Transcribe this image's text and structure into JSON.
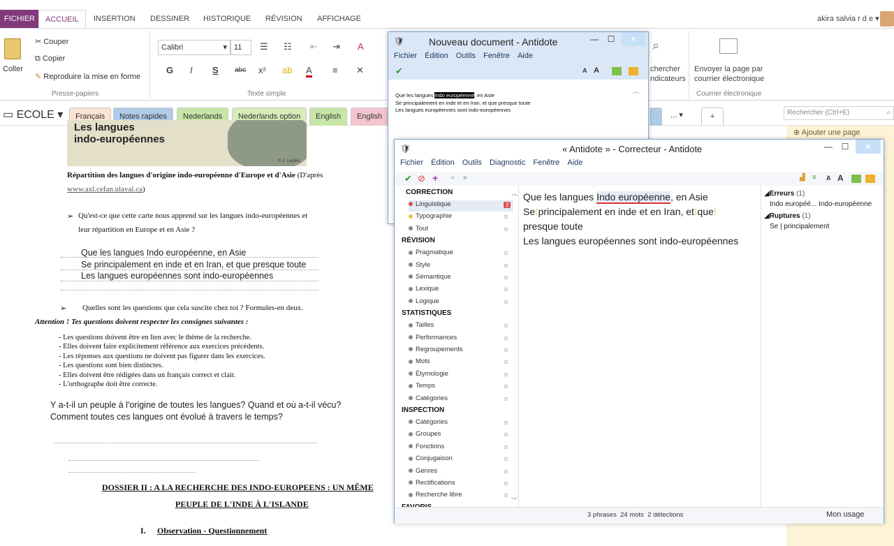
{
  "ribbon": {
    "tabs": [
      "FICHIER",
      "ACCUEIL",
      "INSERTION",
      "DESSINER",
      "HISTORIQUE",
      "RÉVISION",
      "AFFICHAGE"
    ],
    "active_tab": "ACCUEIL",
    "user": "akira salvia r d e",
    "clipboard": {
      "paste": "Coller",
      "cut": "Couper",
      "copy": "Copier",
      "format_painter": "Reproduire la mise en forme",
      "group": "Presse-papiers"
    },
    "font": {
      "name": "Calibri",
      "size": "11",
      "group": "Texte simple"
    },
    "search_tags": {
      "line1": "chercher",
      "line2": "ndicateurs"
    },
    "email": {
      "line1": "Envoyer la page par",
      "line2": "courrier électronique",
      "group": "Courrier électronique"
    }
  },
  "notebook": {
    "name": "ECOLE",
    "sections": [
      "Français",
      "Notes rapides",
      "Nederlands",
      "Nederlands option",
      "English",
      "English o"
    ],
    "section_colors": [
      "#fbe3d3",
      "#aecbe8",
      "#c8e6a7",
      "#d6edb9",
      "#c8e6a7",
      "#f4c5d0"
    ],
    "more": "...",
    "add": "+",
    "search_placeholder": "Rechercher (Ctrl+E)",
    "add_page": "Ajouter une page"
  },
  "page": {
    "map_title_1": "Les langues",
    "map_title_2": "indo-européennes",
    "map_credit": "© J. Leclerc",
    "repartition_bold": "Répartition des langues d'origine indo-européenne d'Europe et d'Asie",
    "repartition_rest": " (D'après",
    "link": "www.axl.cefan.ulaval.ca",
    "link_close": ")",
    "q1_line1": "Qu'est-ce que cette carte nous apprend sur les langues indo-européennes et",
    "q1_line2": "leur répartition en Europe et en Asie ?",
    "ans1": [
      "Que les langues Indo européenne, en Asie",
      "Se principalement en inde et en Iran, et que presque toute",
      "Les langues européennes sont indo-européennes"
    ],
    "q2": "Quelles sont les questions que cela suscite chez toi ? Formules-en deux.",
    "attention": "Attention ! Tes questions doivent respecter les consignes suivantes :",
    "rules": [
      "- Les questions doivent être en lien avec le thème de la recherche.",
      "- Elles doivent faire explicitement référence aux exercices précédents.",
      "- Les réponses aux questions ne doivent pas figurer dans les exercices.",
      "- Les questions sont bien distinctes.",
      "- Elles doivent être rédigées dans un français correct et clair.",
      "- L'orthographe doit être correcte."
    ],
    "ans2": [
      "Y a-t-il un peuple à l'origine de toutes les langues? Quand et où a-t-il vécu?",
      "Comment toutes ces langues ont évolué à travers le temps?"
    ],
    "dossier_1": "DOSSIER II : A LA RECHERCHE DES INDO-EUROPEENS : UN MÊME",
    "dossier_2": "PEUPLE DE L'INDE À L'ISLANDE",
    "obs_num": "I.",
    "obs": "Observation - Questionnement"
  },
  "doc_window": {
    "title": "Nouveau document - Antidote",
    "menu": [
      "Fichier",
      "Édition",
      "Outils",
      "Fenêtre",
      "Aide"
    ],
    "lines": [
      "Que les langues ",
      "Indo européenne",
      ", en Asie",
      "Se principalement en inde et en Iran, et que presque toute",
      "Les langues européennes sont indo-européennes"
    ]
  },
  "corrector": {
    "title": "« Antidote » - Correcteur - Antidote",
    "menu": [
      "Fichier",
      "Édition",
      "Outils",
      "Diagnostic",
      "Fenêtre",
      "Aide"
    ],
    "nav": [
      {
        "type": "section",
        "label": "CORRECTION"
      },
      {
        "type": "item",
        "label": "Linguistique",
        "color": "#e05050",
        "badge": "2",
        "selected": true
      },
      {
        "type": "item",
        "label": "Typographie",
        "color": "#e8c04a"
      },
      {
        "type": "item",
        "label": "Tout",
        "color": "#888"
      },
      {
        "type": "section",
        "label": "RÉVISION"
      },
      {
        "type": "item",
        "label": "Pragmatique",
        "color": "#888"
      },
      {
        "type": "item",
        "label": "Style",
        "color": "#888"
      },
      {
        "type": "item",
        "label": "Sémantique",
        "color": "#888"
      },
      {
        "type": "item",
        "label": "Lexique",
        "color": "#888"
      },
      {
        "type": "item",
        "label": "Logique",
        "color": "#888"
      },
      {
        "type": "section",
        "label": "STATISTIQUES"
      },
      {
        "type": "item",
        "label": "Tailles",
        "color": "#888"
      },
      {
        "type": "item",
        "label": "Performances",
        "color": "#888"
      },
      {
        "type": "item",
        "label": "Regroupements",
        "color": "#888"
      },
      {
        "type": "item",
        "label": "Mots",
        "color": "#888"
      },
      {
        "type": "item",
        "label": "Étymologie",
        "color": "#888"
      },
      {
        "type": "item",
        "label": "Temps",
        "color": "#888"
      },
      {
        "type": "item",
        "label": "Catégories",
        "color": "#888"
      },
      {
        "type": "section",
        "label": "INSPECTION"
      },
      {
        "type": "item",
        "label": "Catégories",
        "color": "#888"
      },
      {
        "type": "item",
        "label": "Groupes",
        "color": "#888"
      },
      {
        "type": "item",
        "label": "Fonctions",
        "color": "#888"
      },
      {
        "type": "item",
        "label": "Conjugaison",
        "color": "#888"
      },
      {
        "type": "item",
        "label": "Genres",
        "color": "#888"
      },
      {
        "type": "item",
        "label": "Rectifications",
        "color": "#888"
      },
      {
        "type": "item",
        "label": "Recherche libre",
        "color": "#888"
      },
      {
        "type": "section",
        "label": "FAVORIS"
      }
    ],
    "text": {
      "l1a": "Que les langues ",
      "l1b": "Indo européenne",
      "l1c": ", en Asie",
      "l2a": "Se",
      "l2b": "principalement en inde et en Iran, et",
      "l2c": "que",
      "l3": "presque toute",
      "l4": "Les langues européennes sont indo-européennes"
    },
    "errors": {
      "head": "Erreurs",
      "count": "(1)",
      "item": "Indo européé... Indo-européenne",
      "ruptures": "Ruptures",
      "rcount": "(1)",
      "ritem": "Se | principalement"
    },
    "status": "3 phrases  24 mots  2 détections",
    "usage": "Mon usage"
  }
}
